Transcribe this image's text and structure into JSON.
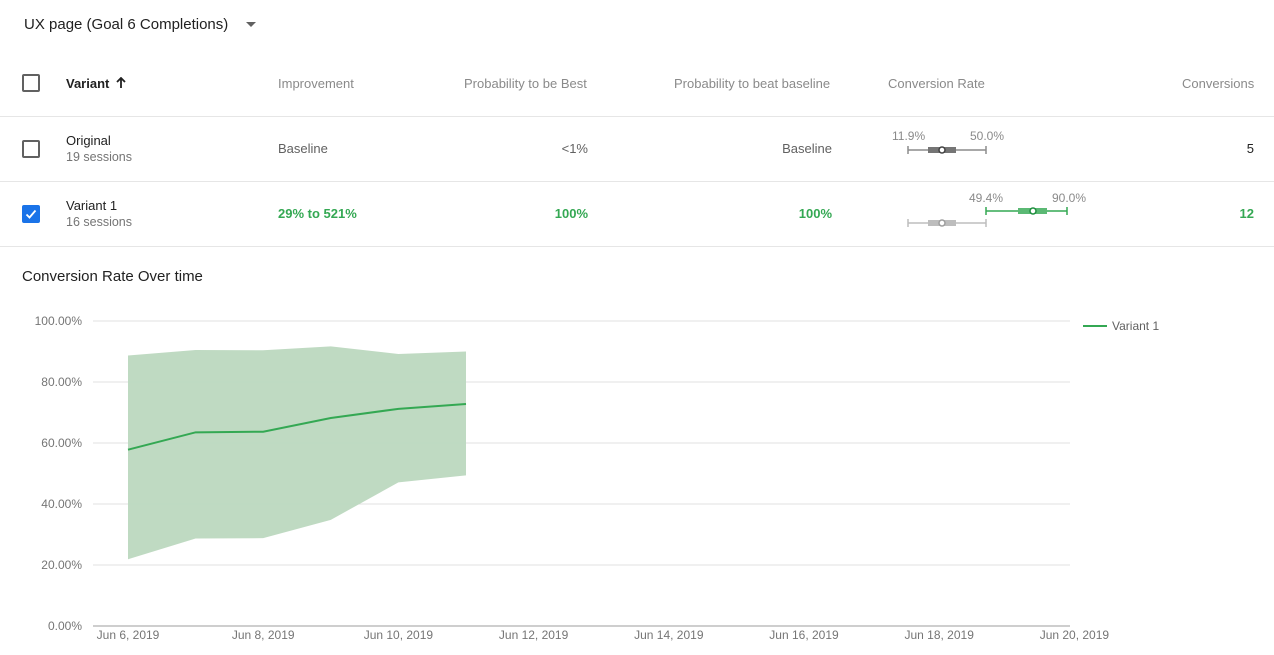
{
  "selector": {
    "label": "UX page (Goal 6 Completions)"
  },
  "table": {
    "headers": {
      "variant": "Variant",
      "improvement": "Improvement",
      "prob_best": "Probability to be Best",
      "prob_beat": "Probability to beat baseline",
      "conv_rate": "Conversion Rate",
      "conversions": "Conversions"
    },
    "rows": [
      {
        "name": "Original",
        "sessions": "19 sessions",
        "improvement": "Baseline",
        "prob_best": "<1%",
        "prob_beat": "Baseline",
        "ci_low": "11.9%",
        "ci_high": "50.0%",
        "conversions": "5",
        "checked": false
      },
      {
        "name": "Variant 1",
        "sessions": "16 sessions",
        "improvement": "29% to 521%",
        "prob_best": "100%",
        "prob_beat": "100%",
        "ci_low": "49.4%",
        "ci_high": "90.0%",
        "conversions": "12",
        "checked": true
      }
    ]
  },
  "chart": {
    "title": "Conversion Rate Over time",
    "legend": "Variant 1"
  },
  "colors": {
    "accent_green": "#34a853",
    "band_green": "#bcd8bf",
    "checkbox_blue": "#1a73e8",
    "baseline_gray": "#9e9e9e"
  },
  "chart_data": {
    "type": "line",
    "title": "Conversion Rate Over time",
    "x": [
      "Jun 6, 2019",
      "Jun 7, 2019",
      "Jun 8, 2019",
      "Jun 9, 2019",
      "Jun 10, 2019",
      "Jun 11, 2019"
    ],
    "series": [
      {
        "name": "Variant 1",
        "values": [
          57.8,
          63.5,
          63.7,
          68.2,
          71.2,
          72.8
        ],
        "upper": [
          88.7,
          90.5,
          90.4,
          91.7,
          89.2,
          90.0
        ],
        "lower": [
          21.9,
          28.7,
          28.8,
          34.8,
          47.1,
          49.4
        ]
      }
    ],
    "x_ticks": [
      "Jun 6, 2019",
      "Jun 8, 2019",
      "Jun 10, 2019",
      "Jun 12, 2019",
      "Jun 14, 2019",
      "Jun 16, 2019",
      "Jun 18, 2019",
      "Jun 20, 2019"
    ],
    "y_ticks": [
      "0.00%",
      "20.00%",
      "40.00%",
      "60.00%",
      "80.00%",
      "100.00%"
    ],
    "ylim": [
      0,
      100
    ],
    "xlim_days": [
      "Jun 6, 2019",
      "Jun 20, 2019"
    ],
    "grid": true,
    "legend_position": "right"
  }
}
